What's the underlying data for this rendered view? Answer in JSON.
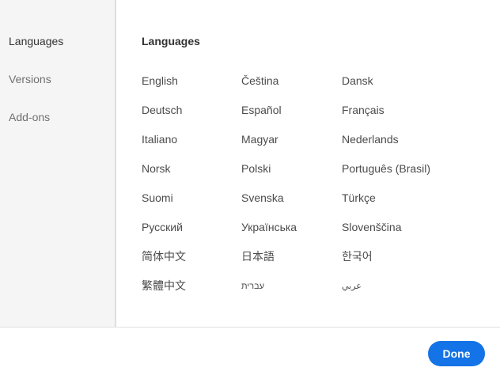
{
  "sidebar": {
    "items": [
      {
        "label": "Languages",
        "active": true
      },
      {
        "label": "Versions",
        "active": false
      },
      {
        "label": "Add-ons",
        "active": false
      }
    ]
  },
  "main": {
    "section_title": "Languages",
    "languages": [
      [
        "English",
        "Čeština",
        "Dansk"
      ],
      [
        "Deutsch",
        "Español",
        "Français"
      ],
      [
        "Italiano",
        "Magyar",
        "Nederlands"
      ],
      [
        "Norsk",
        "Polski",
        "Português (Brasil)"
      ],
      [
        "Suomi",
        "Svenska",
        "Türkçe"
      ],
      [
        "Русский",
        "Українська",
        "Slovenščina"
      ],
      [
        "简体中文",
        "日本語",
        "한국어"
      ],
      [
        "繁體中文",
        "עברית",
        "عربي"
      ]
    ]
  },
  "footer": {
    "done_label": "Done"
  },
  "colors": {
    "accent": "#1473e6",
    "sidebar_bg": "#f5f5f5",
    "text": "#4b4b4b"
  }
}
